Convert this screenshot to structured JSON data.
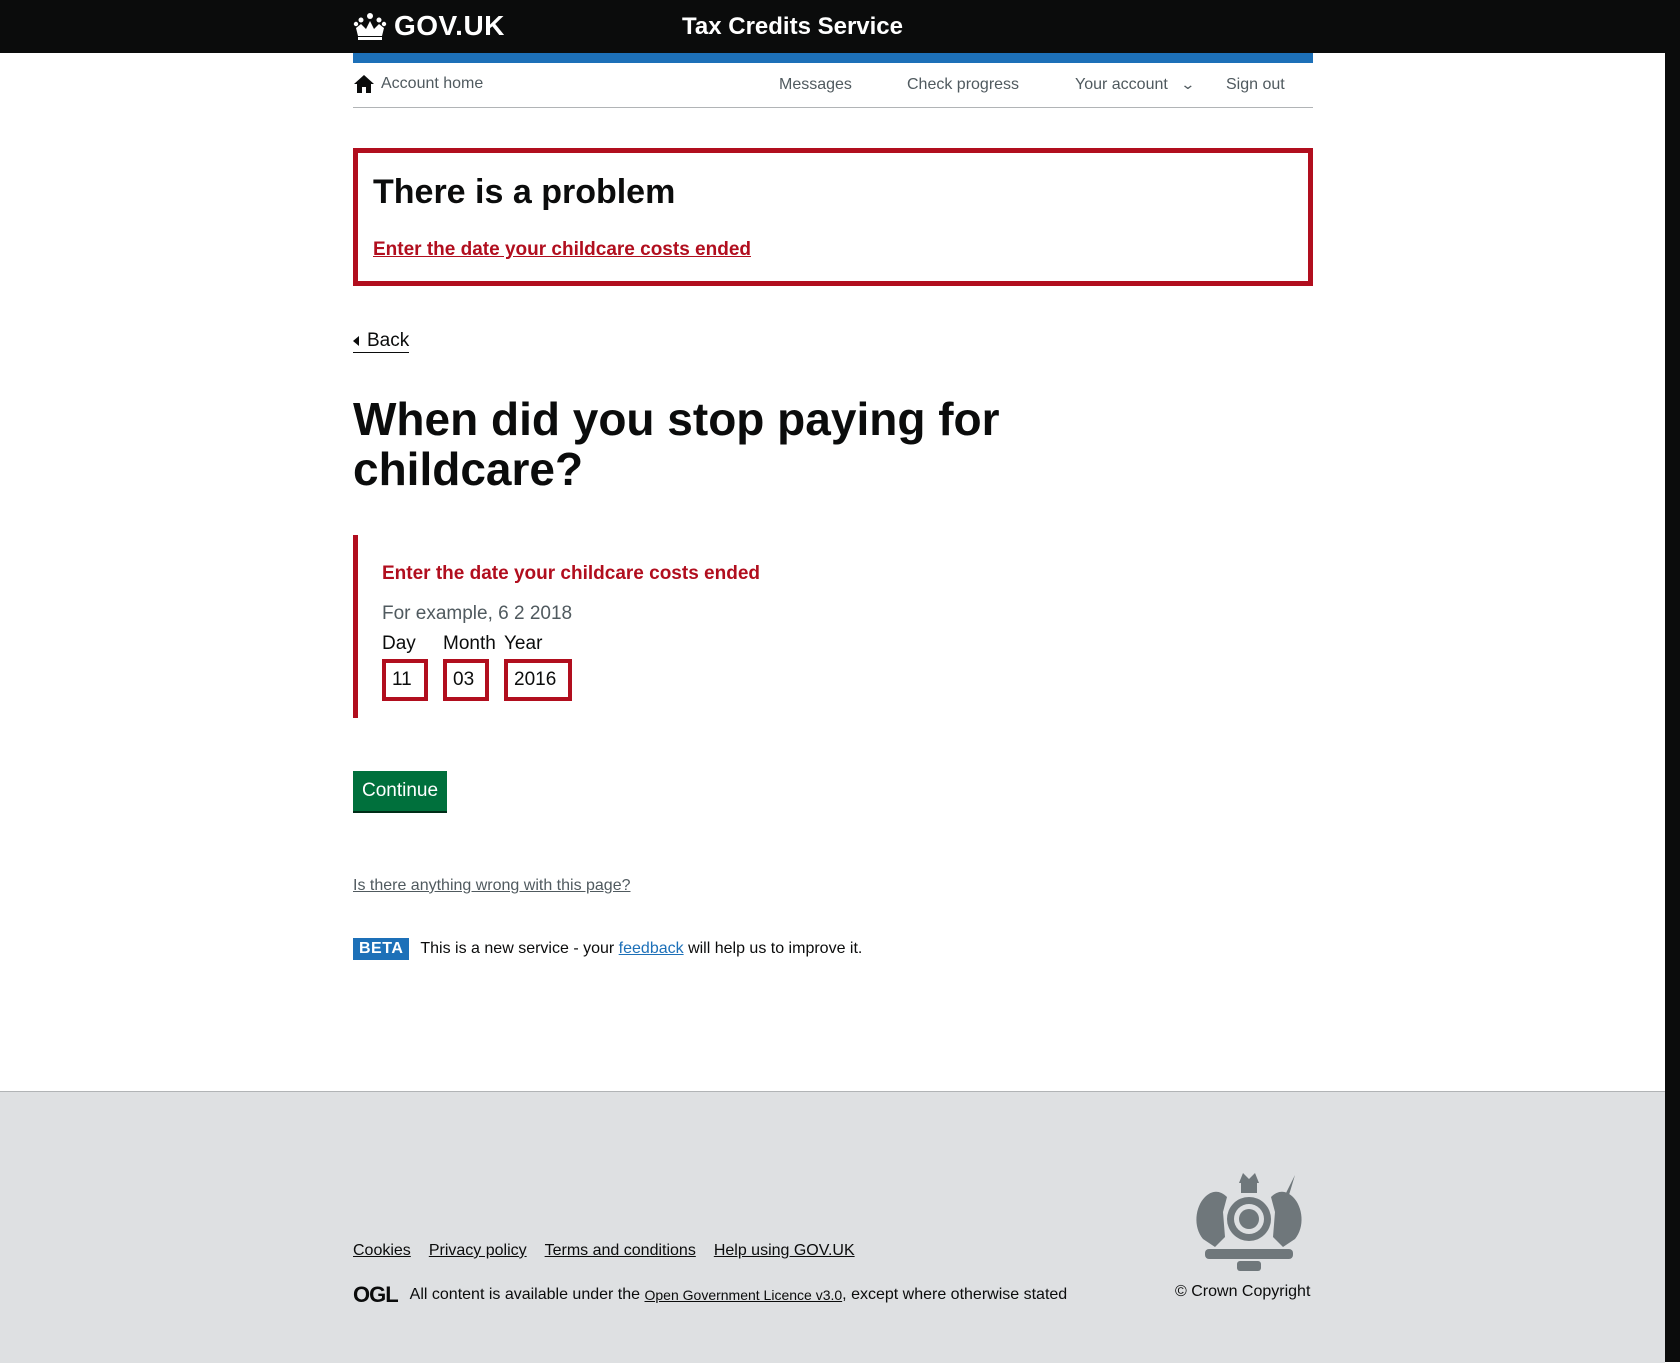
{
  "header": {
    "logo_text": "GOV.UK",
    "service_name": "Tax Credits Service",
    "brand_blue": "#1d70b8"
  },
  "account_nav": {
    "home_label": "Account home",
    "items": [
      "Messages",
      "Check progress",
      "Your account",
      "Sign out"
    ],
    "home_icon": "home-icon",
    "dropdown_icon": "chevron-down-icon"
  },
  "error_summary": {
    "title": "There is a problem",
    "link": "Enter the date your childcare costs ended",
    "error_color": "#b10e1e"
  },
  "back_label": "Back",
  "page_title": "When did you stop paying for childcare?",
  "date_field": {
    "error_message": "Enter the date your childcare costs ended",
    "hint": "For example, 6 2 2018",
    "day_label": "Day",
    "month_label": "Month",
    "year_label": "Year",
    "day_value": "11",
    "month_value": "03",
    "year_value": "2016"
  },
  "continue_label": "Continue",
  "report_link": "Is there anything wrong with this page?",
  "beta": {
    "tag": "BETA",
    "text_before": "This is a new service  - your",
    "feedback_link": "feedback",
    "text_after": "will help us to improve it."
  },
  "footer": {
    "links": [
      "Cookies",
      "Privacy policy",
      "Terms and conditions",
      "Help using GOV.UK"
    ],
    "ogl_logo": "OGL",
    "licence_before": "All content is available under the",
    "licence_link": "Open Government Licence v3.0",
    "licence_after": ", except where otherwise stated",
    "copyright": "© Crown Copyright",
    "crest_icon": "royal-coat-of-arms-icon"
  }
}
